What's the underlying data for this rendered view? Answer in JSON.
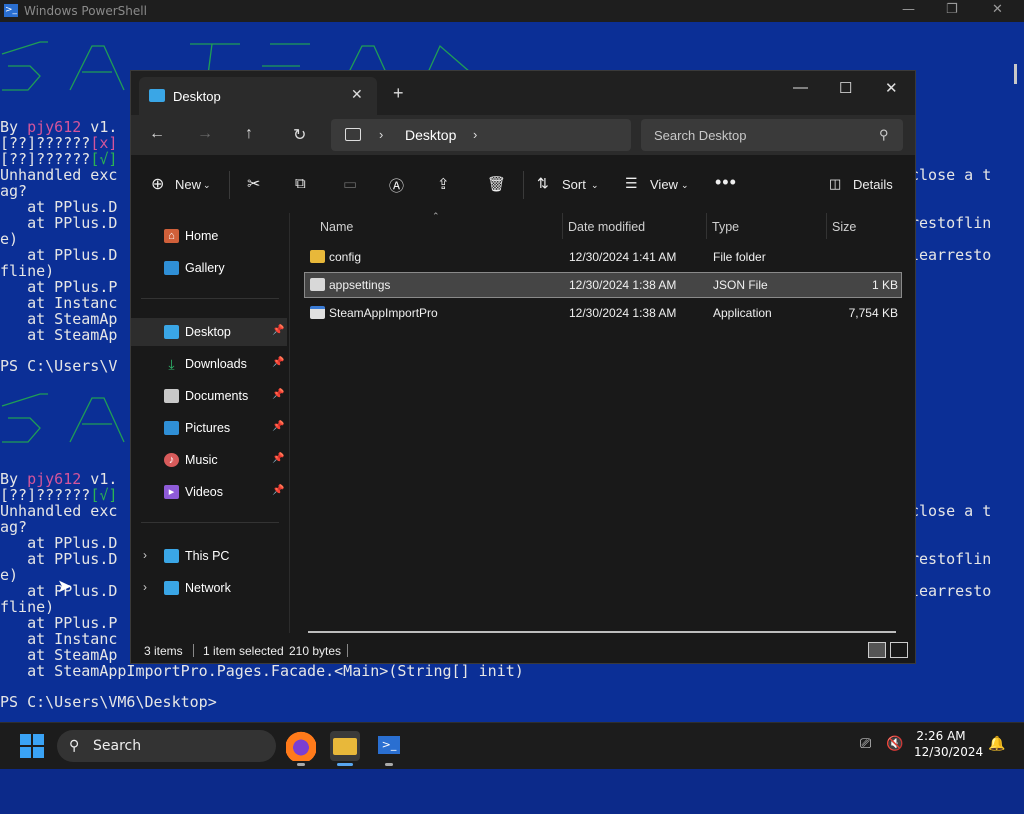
{
  "powershell": {
    "title": "Windows PowerShell",
    "lines_left": [
      {
        "text": "By pjy612 v1.",
        "class": ""
      },
      {
        "text": "[??]??????[x]",
        "class": ""
      },
      {
        "text": "[??]??????[√]",
        "class": ""
      },
      {
        "text": "Unhandled exc",
        "class": ""
      },
      {
        "text": "ag?",
        "class": ""
      },
      {
        "text": "   at PPlus.D",
        "class": ""
      },
      {
        "text": "   at PPlus.D",
        "class": ""
      },
      {
        "text": "e)",
        "class": ""
      },
      {
        "text": "   at PPlus.D",
        "class": ""
      },
      {
        "text": "fline)",
        "class": ""
      },
      {
        "text": "   at PPlus.P",
        "class": ""
      },
      {
        "text": "   at Instanc",
        "class": ""
      },
      {
        "text": "   at SteamAp",
        "class": ""
      },
      {
        "text": "   at SteamAp",
        "class": ""
      },
      {
        "text": "PS C:\\Users\\V",
        "class": ""
      },
      {
        "text": "By pjy612 v1.",
        "class": ""
      },
      {
        "text": "[??]??????[√]",
        "class": ""
      },
      {
        "text": "Unhandled exc",
        "class": ""
      },
      {
        "text": "ag?",
        "class": ""
      },
      {
        "text": "   at PPlus.D",
        "class": ""
      },
      {
        "text": "   at PPlus.D",
        "class": ""
      },
      {
        "text": "e)",
        "class": ""
      },
      {
        "text": "   at PPlus.D",
        "class": ""
      },
      {
        "text": "fline)",
        "class": ""
      },
      {
        "text": "   at PPlus.P",
        "class": ""
      },
      {
        "text": "   at Instanc",
        "class": ""
      },
      {
        "text": "   at SteamAp",
        "class": ""
      },
      {
        "text": "   at SteamAppImportPro.Pages.Facade.<Main>(String[] init)",
        "class": ""
      },
      {
        "text": "PS C:\\Users\\VM6\\Desktop>",
        "class": ""
      }
    ],
    "right_fragments": [
      "close a t",
      "restoflin",
      "learresto",
      "close a t",
      "restoflin",
      "learresto"
    ]
  },
  "explorer": {
    "tab_title": "Desktop",
    "breadcrumb": "Desktop",
    "search_placeholder": "Search Desktop",
    "toolbar": {
      "new_label": "New",
      "sort_label": "Sort",
      "view_label": "View",
      "details_label": "Details"
    },
    "sidebar": {
      "home": "Home",
      "gallery": "Gallery",
      "desktop": "Desktop",
      "downloads": "Downloads",
      "documents": "Documents",
      "pictures": "Pictures",
      "music": "Music",
      "videos": "Videos",
      "this_pc": "This PC",
      "network": "Network"
    },
    "columns": {
      "name": "Name",
      "date": "Date modified",
      "type": "Type",
      "size": "Size"
    },
    "files": [
      {
        "name": "config",
        "date": "12/30/2024 1:41 AM",
        "type": "File folder",
        "size": ""
      },
      {
        "name": "appsettings",
        "date": "12/30/2024 1:38 AM",
        "type": "JSON File",
        "size": "1 KB"
      },
      {
        "name": "SteamAppImportPro",
        "date": "12/30/2024 1:38 AM",
        "type": "Application",
        "size": "7,754 KB"
      }
    ],
    "status": {
      "items": "3 items",
      "selected": "1 item selected",
      "size": "210 bytes"
    }
  },
  "taskbar": {
    "search_label": "Search",
    "time": "2:26 AM",
    "date": "12/30/2024"
  }
}
